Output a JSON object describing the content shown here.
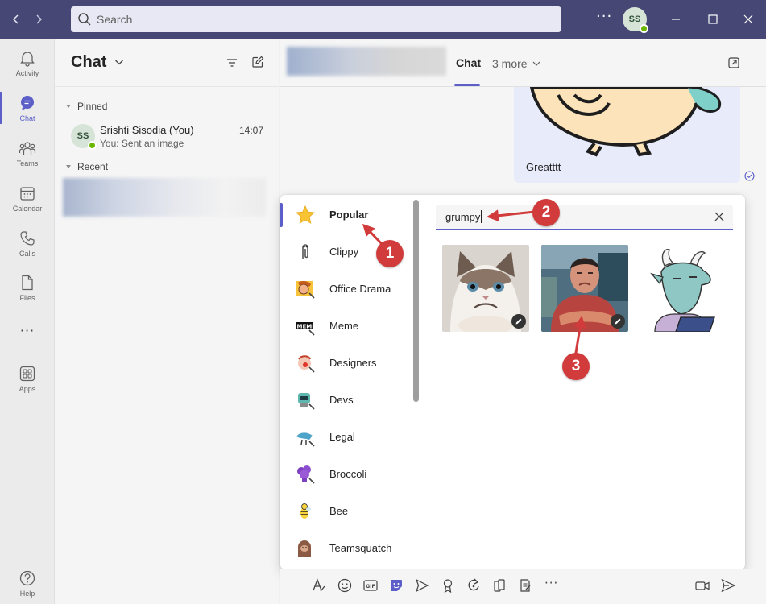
{
  "titlebar": {
    "search_placeholder": "Search",
    "more_label": "···",
    "user_initials": "SS",
    "back_icon": "chevron-left-icon",
    "forward_icon": "chevron-right-icon"
  },
  "rail": {
    "items": [
      {
        "label": "Activity",
        "icon": "bell-icon"
      },
      {
        "label": "Chat",
        "icon": "chat-icon",
        "active": true
      },
      {
        "label": "Teams",
        "icon": "teams-icon"
      },
      {
        "label": "Calendar",
        "icon": "calendar-icon"
      },
      {
        "label": "Calls",
        "icon": "phone-icon"
      },
      {
        "label": "Files",
        "icon": "file-icon"
      },
      {
        "label": "···",
        "icon": "more-icon"
      },
      {
        "label": "Apps",
        "icon": "apps-icon"
      },
      {
        "label": "Help",
        "icon": "help-icon"
      }
    ]
  },
  "chatlist": {
    "title": "Chat",
    "pinned_label": "Pinned",
    "recent_label": "Recent",
    "pinned_chat": {
      "initials": "SS",
      "name": "Srishti Sisodia (You)",
      "time": "14:07",
      "preview": "You: Sent an image"
    }
  },
  "main": {
    "tab_chat": "Chat",
    "tab_more": "3 more",
    "message_text": "Greatttt"
  },
  "picker": {
    "categories": [
      {
        "label": "Popular",
        "active": true
      },
      {
        "label": "Clippy"
      },
      {
        "label": "Office Drama"
      },
      {
        "label": "Meme"
      },
      {
        "label": "Designers"
      },
      {
        "label": "Devs"
      },
      {
        "label": "Legal"
      },
      {
        "label": "Broccoli"
      },
      {
        "label": "Bee"
      },
      {
        "label": "Teamsquatch"
      }
    ],
    "search_value": "grumpy",
    "results": [
      "grumpy-cat-sticker",
      "grumpy-man-sticker",
      "grumpy-goat-sticker"
    ]
  },
  "annotations": {
    "step1": "1",
    "step2": "2",
    "step3": "3",
    "color": "#d23b3b"
  },
  "colors": {
    "titlebar": "#464775",
    "accent": "#5b5fc7",
    "presence": "#6bb700"
  }
}
